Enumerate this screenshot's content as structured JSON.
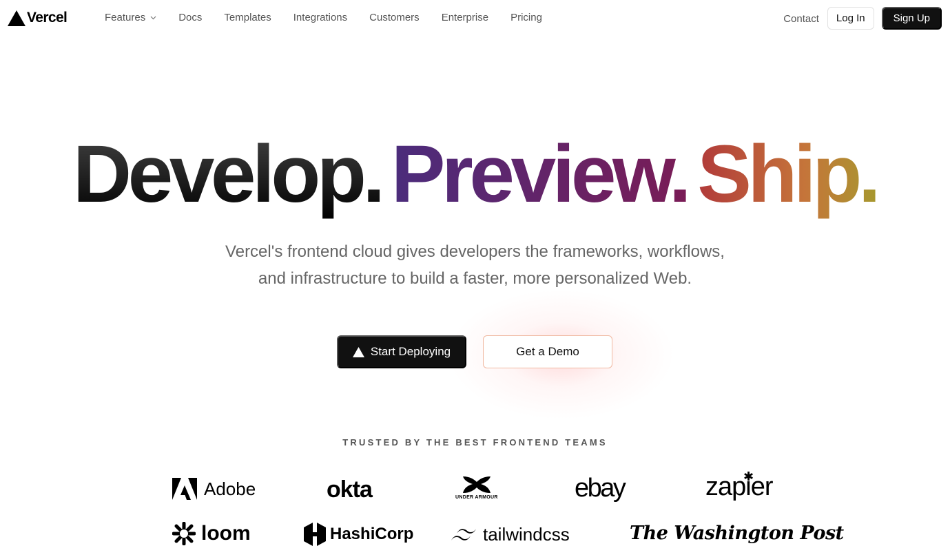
{
  "brand": {
    "name": "Vercel",
    "logo_icon": "vercel-triangle-icon"
  },
  "nav": {
    "items": [
      {
        "label": "Features",
        "has_dropdown": true
      },
      {
        "label": "Docs"
      },
      {
        "label": "Templates"
      },
      {
        "label": "Integrations"
      },
      {
        "label": "Customers"
      },
      {
        "label": "Enterprise"
      },
      {
        "label": "Pricing"
      }
    ],
    "contact": "Contact",
    "login": "Log In",
    "signup": "Sign Up"
  },
  "hero": {
    "word1": "Develop.",
    "word2": "Preview.",
    "word3": "Ship.",
    "subtitle_line1": "Vercel's frontend cloud gives developers the frameworks, workflows,",
    "subtitle_line2": "and infrastructure to build a faster, more personalized Web.",
    "cta_primary": "Start Deploying",
    "cta_secondary": "Get a Demo"
  },
  "trusted": {
    "heading": "TRUSTED BY THE BEST FRONTEND TEAMS",
    "logos": {
      "adobe": "Adobe",
      "okta": "okta",
      "under_armour": "UNDER ARMOUR",
      "ebay": "ebay",
      "zapier": "zapier",
      "loom": "loom",
      "hashicorp": "HashiCorp",
      "tailwind": "tailwindcss",
      "wapo": "The Washington Post"
    }
  },
  "colors": {
    "primary_dark": "#111111",
    "nav_text": "#555555",
    "preview_gradient_start": "#4b2c7c",
    "preview_gradient_end": "#7a1c56",
    "ship_gradient_start": "#b13a3a",
    "ship_gradient_end": "#a7982e"
  }
}
